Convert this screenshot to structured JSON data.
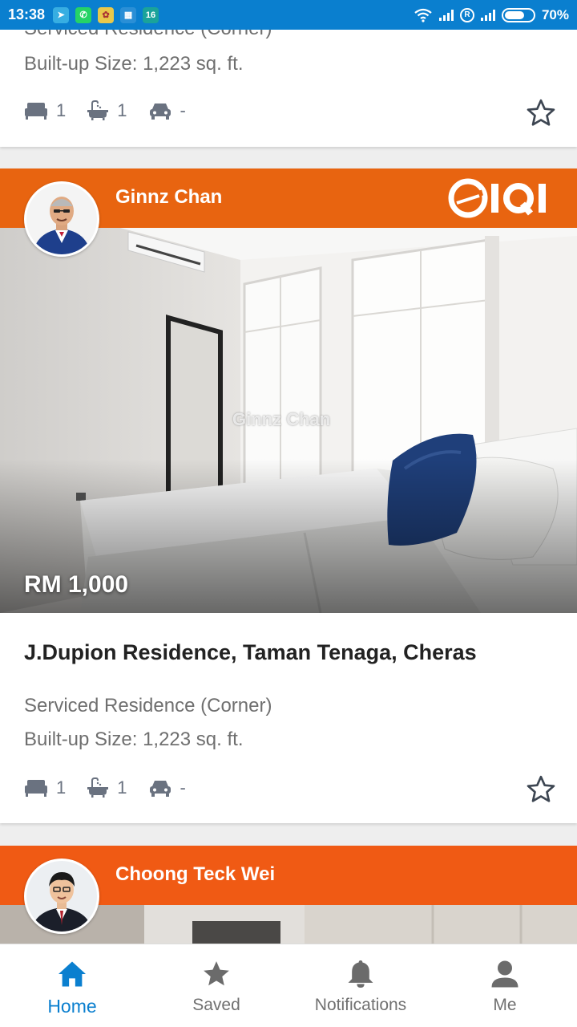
{
  "status_bar": {
    "time": "13:38",
    "battery": "70%",
    "notification_badge": "16",
    "accent_color": "#0a7fcf"
  },
  "listings": [
    {
      "property_type": "Serviced Residence (Corner)",
      "built_up": "Built-up Size: 1,223 sq. ft.",
      "bedrooms": "1",
      "bathrooms": "1",
      "parking": "-"
    },
    {
      "agent_name": "Ginnz Chan",
      "agency_logo": "IQI",
      "watermark": "Ginnz Chan",
      "price": "RM 1,000",
      "title": "J.Dupion Residence, Taman Tenaga, Cheras",
      "property_type": "Serviced Residence (Corner)",
      "built_up": "Built-up Size: 1,223 sq. ft.",
      "bedrooms": "1",
      "bathrooms": "1",
      "parking": "-"
    },
    {
      "agent_name": "Choong Teck Wei"
    }
  ],
  "header_color": "#f05a14",
  "bottom_nav": [
    {
      "label": "Home",
      "icon": "home-icon",
      "active": true
    },
    {
      "label": "Saved",
      "icon": "star-icon",
      "active": false
    },
    {
      "label": "Notifications",
      "icon": "bell-icon",
      "active": false
    },
    {
      "label": "Me",
      "icon": "person-icon",
      "active": false
    }
  ]
}
